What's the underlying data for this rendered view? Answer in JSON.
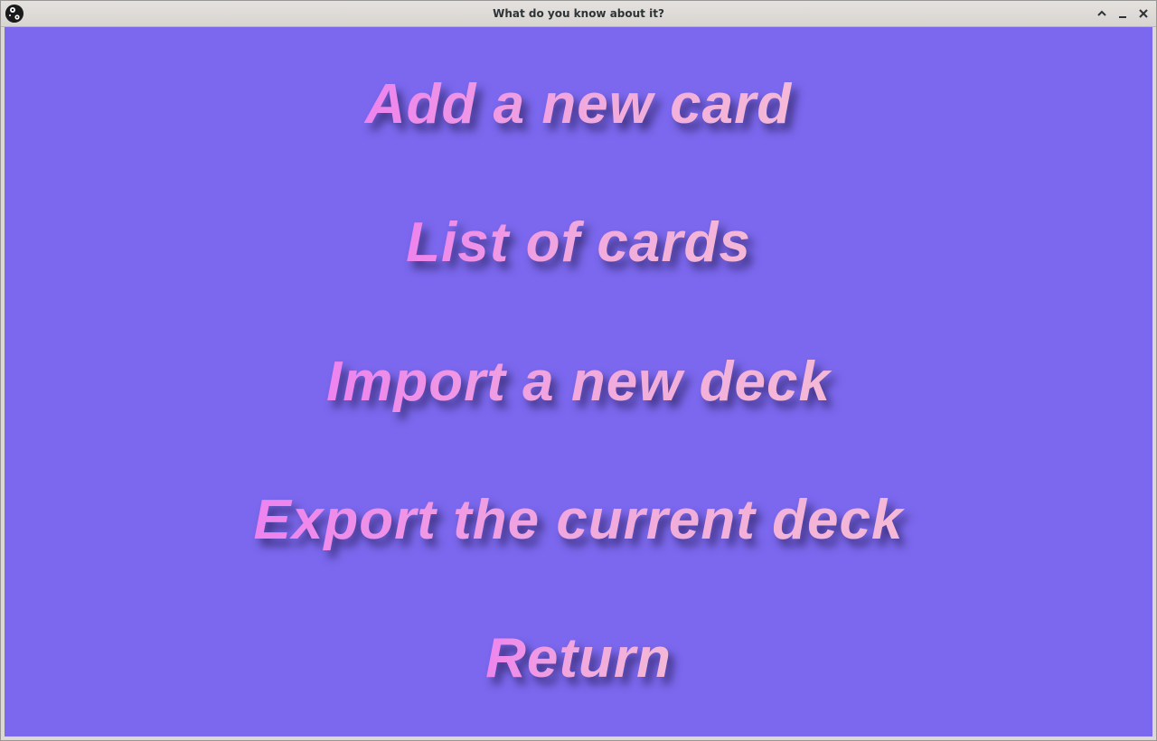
{
  "window": {
    "title": "What do you know about it?",
    "controls": [
      "maximize-icon",
      "minimize-icon",
      "close-icon"
    ]
  },
  "menu": {
    "items": [
      {
        "label": "Add a new card"
      },
      {
        "label": "List of cards"
      },
      {
        "label": "Import a new deck"
      },
      {
        "label": "Export the current deck"
      },
      {
        "label": "Return"
      }
    ]
  },
  "colors": {
    "background": "#7b68ee",
    "text_gradient_start": "#ee82ee",
    "text_gradient_end": "#f5b9d6",
    "titlebar": "#dcd9d5"
  }
}
